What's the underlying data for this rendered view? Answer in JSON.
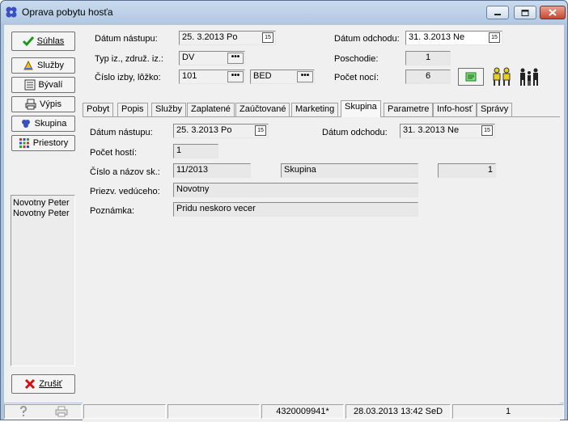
{
  "window": {
    "title": "Oprava pobytu hosťa"
  },
  "sidebar": {
    "accept_label": "Súhlas",
    "services_label": "Služby",
    "former_label": "Bývalí",
    "print_label": "Výpis",
    "group_label": "Skupina",
    "rooms_label": "Priestory",
    "cancel_label": "Zrušiť",
    "guests": [
      "Novotny Peter",
      "Novotny Peter"
    ]
  },
  "header": {
    "arrival_label": "Dátum nástupu:",
    "arrival_value": "25. 3.2013  Po",
    "departure_label": "Dátum odchodu:",
    "departure_value": "31. 3.2013  Ne",
    "type_label": "Typ iz., združ. iz.:",
    "type_value": "DV",
    "floor_label": "Poschodie:",
    "floor_value": "1",
    "room_label": "Číslo izby, lôžko:",
    "room_value": "101",
    "bed_value": "BED",
    "nights_label": "Počet nocí:",
    "nights_value": "6"
  },
  "tabs": [
    "Pobyt",
    "Popis",
    "Služby",
    "Zaplatené",
    "Zaúčtované",
    "Marketing",
    "Skupina",
    "Parametre",
    "Info-hosť",
    "Správy"
  ],
  "active_tab": "Skupina",
  "group_tab": {
    "arrival_label": "Dátum nástupu:",
    "arrival_value": "25. 3.2013  Po",
    "departure_label": "Dátum odchodu:",
    "departure_value": "31. 3.2013  Ne",
    "guests_label": "Počet hostí:",
    "guests_value": "1",
    "group_no_label": "Číslo a názov sk.:",
    "group_no_value": "11/2013",
    "group_name_value": "Skupina",
    "group_count_value": "1",
    "leader_label": "Priezv. vedúceho:",
    "leader_value": "Novotny",
    "note_label": "Poznámka:",
    "note_value": "Pridu neskoro vecer"
  },
  "status": {
    "code": "4320009941*",
    "datetime": "28.03.2013 13:42 SeD",
    "page": "1"
  }
}
